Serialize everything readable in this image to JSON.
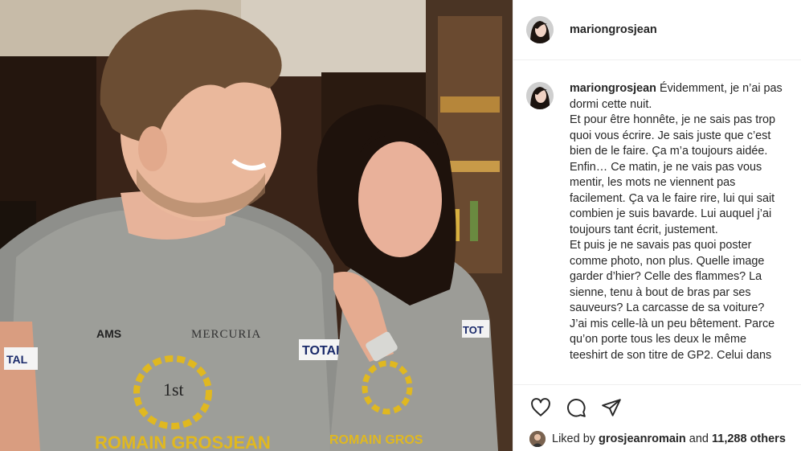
{
  "post": {
    "username": "mariongrosjean",
    "caption_user": "mariongrosjean",
    "caption_text": " Évidemment, je n’ai pas dormi cette nuit.\nEt pour être honnête, je ne sais pas trop quoi vous écrire. Je sais juste que c’est bien de le faire. Ça m’a toujours aidée.\nEnfin… Ce matin, je ne vais pas vous mentir, les mots ne viennent pas facilement. Ça va le faire rire, lui qui sait combien je suis bavarde. Lui auquel j’ai toujours tant écrit, justement.\nEt puis je ne savais pas quoi poster comme photo, non plus. Quelle image garder d’hier? Celle des flammes? La sienne, tenu à bout de bras par ses sauveurs? La carcasse de sa voiture?\nJ’ai mis celle-là un peu bêtement. Parce qu’on porte tous les deux le même teeshirt de son titre de GP2. Celui dans",
    "liked_prefix": "Liked by",
    "liked_user": "grosjeanromain",
    "liked_and": "and",
    "liked_others": "11,288 others"
  },
  "photo": {
    "shirt_text_left": "AMS",
    "shirt_sponsor": "MERCURIA",
    "shirt_total": "TOTAL",
    "shirt_position": "1st",
    "shirt_name": "ROMAIN GROSJEAN"
  },
  "icons": [
    "heart-icon",
    "comment-icon",
    "share-icon"
  ]
}
